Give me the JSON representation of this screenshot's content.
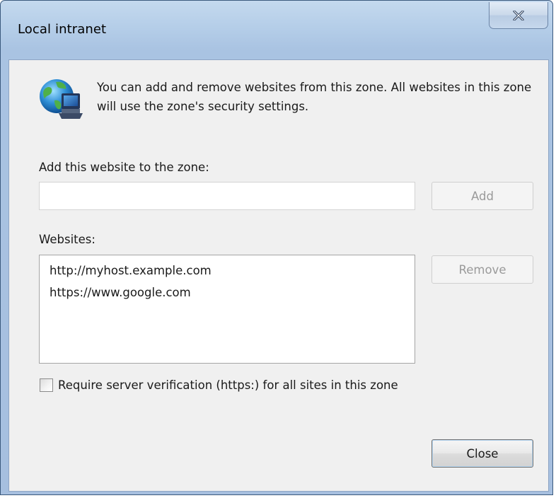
{
  "window": {
    "title": "Local intranet"
  },
  "intro": {
    "text": "You can add and remove websites from this zone. All websites in this zone will use the zone's security settings.",
    "icon": "globe-network-icon"
  },
  "add_section": {
    "label": "Add this website to the zone:",
    "input_value": "",
    "add_label": "Add"
  },
  "websites_section": {
    "label": "Websites:",
    "items": [
      "http://myhost.example.com",
      "https://www.google.com"
    ],
    "remove_label": "Remove"
  },
  "verification": {
    "label": "Require server verification (https:) for all sites in this zone",
    "checked": false
  },
  "footer": {
    "close_label": "Close"
  },
  "colors": {
    "titlebar": "#b4cde8",
    "client_bg": "#f0f0f0",
    "disabled_text": "#9a9a9a"
  }
}
